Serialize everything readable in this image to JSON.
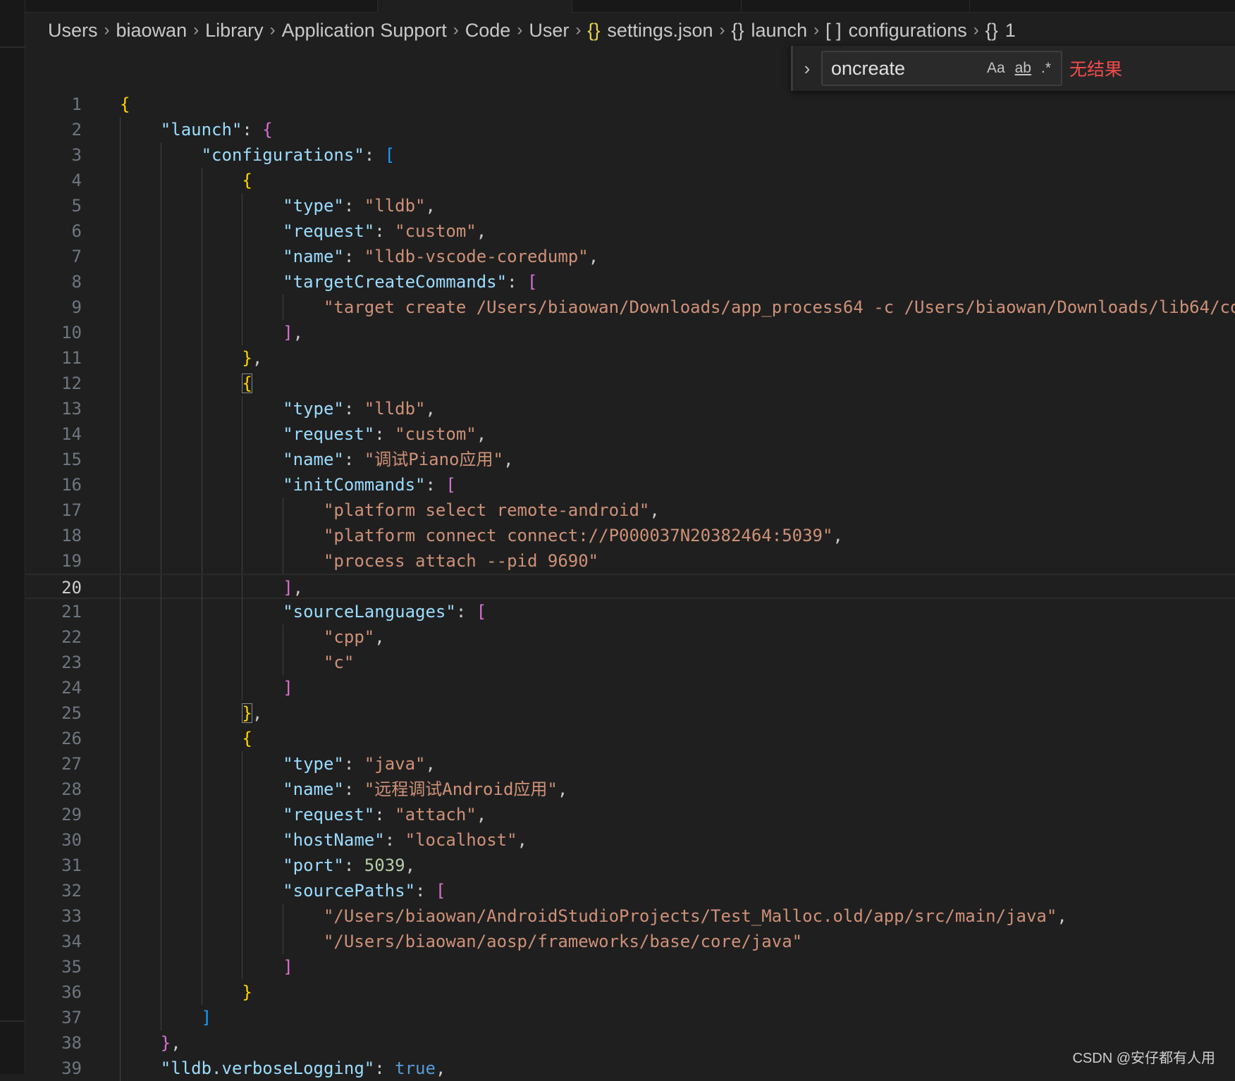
{
  "breadcrumb": [
    {
      "label": "Users"
    },
    {
      "label": "biaowan"
    },
    {
      "label": "Library"
    },
    {
      "label": "Application Support"
    },
    {
      "label": "Code"
    },
    {
      "label": "User"
    },
    {
      "icon": "{}",
      "icon_name": "json-file-icon",
      "label": "settings.json"
    },
    {
      "icon": "{}",
      "icon_name": "object-icon",
      "label": "launch"
    },
    {
      "icon": "[ ]",
      "icon_name": "array-icon",
      "label": "configurations"
    },
    {
      "icon": "{}",
      "icon_name": "object-icon",
      "label": "1"
    }
  ],
  "find": {
    "value": "oncreate",
    "match_case": "Aa",
    "whole_word": "ab",
    "regex": ".*",
    "result": "无结果",
    "toggle": "›"
  },
  "editor": {
    "current_line": 20,
    "matched_brackets": [
      12,
      25
    ],
    "lines": [
      [
        [
          "y",
          "{"
        ]
      ],
      [
        [
          "w",
          "    "
        ],
        [
          "k",
          "\"launch\""
        ],
        [
          "p",
          ": "
        ],
        [
          "m",
          "{"
        ]
      ],
      [
        [
          "w",
          "        "
        ],
        [
          "k",
          "\"configurations\""
        ],
        [
          "p",
          ": "
        ],
        [
          "c",
          "["
        ]
      ],
      [
        [
          "w",
          "            "
        ],
        [
          "y",
          "{"
        ]
      ],
      [
        [
          "w",
          "                "
        ],
        [
          "k",
          "\"type\""
        ],
        [
          "p",
          ": "
        ],
        [
          "s",
          "\"lldb\""
        ],
        [
          "p",
          ","
        ]
      ],
      [
        [
          "w",
          "                "
        ],
        [
          "k",
          "\"request\""
        ],
        [
          "p",
          ": "
        ],
        [
          "s",
          "\"custom\""
        ],
        [
          "p",
          ","
        ]
      ],
      [
        [
          "w",
          "                "
        ],
        [
          "k",
          "\"name\""
        ],
        [
          "p",
          ": "
        ],
        [
          "s",
          "\"lldb-vscode-coredump\""
        ],
        [
          "p",
          ","
        ]
      ],
      [
        [
          "w",
          "                "
        ],
        [
          "k",
          "\"targetCreateCommands\""
        ],
        [
          "p",
          ": "
        ],
        [
          "m",
          "["
        ]
      ],
      [
        [
          "w",
          "                    "
        ],
        [
          "s",
          "\"target create /Users/biaowan/Downloads/app_process64 -c /Users/biaowan/Downloads/lib64/co"
        ]
      ],
      [
        [
          "w",
          "                "
        ],
        [
          "m",
          "]"
        ],
        [
          "p",
          ","
        ]
      ],
      [
        [
          "w",
          "            "
        ],
        [
          "y",
          "}"
        ],
        [
          "p",
          ","
        ]
      ],
      [
        [
          "w",
          "            "
        ],
        [
          "y",
          "{"
        ]
      ],
      [
        [
          "w",
          "                "
        ],
        [
          "k",
          "\"type\""
        ],
        [
          "p",
          ": "
        ],
        [
          "s",
          "\"lldb\""
        ],
        [
          "p",
          ","
        ]
      ],
      [
        [
          "w",
          "                "
        ],
        [
          "k",
          "\"request\""
        ],
        [
          "p",
          ": "
        ],
        [
          "s",
          "\"custom\""
        ],
        [
          "p",
          ","
        ]
      ],
      [
        [
          "w",
          "                "
        ],
        [
          "k",
          "\"name\""
        ],
        [
          "p",
          ": "
        ],
        [
          "s",
          "\"调试Piano应用\""
        ],
        [
          "p",
          ","
        ]
      ],
      [
        [
          "w",
          "                "
        ],
        [
          "k",
          "\"initCommands\""
        ],
        [
          "p",
          ": "
        ],
        [
          "m",
          "["
        ]
      ],
      [
        [
          "w",
          "                    "
        ],
        [
          "s",
          "\"platform select remote-android\""
        ],
        [
          "p",
          ","
        ]
      ],
      [
        [
          "w",
          "                    "
        ],
        [
          "s",
          "\"platform connect connect://P000037N20382464:5039\""
        ],
        [
          "p",
          ","
        ]
      ],
      [
        [
          "w",
          "                    "
        ],
        [
          "s",
          "\"process attach --pid 9690\""
        ]
      ],
      [
        [
          "w",
          "                "
        ],
        [
          "m",
          "]"
        ],
        [
          "p",
          ","
        ]
      ],
      [
        [
          "w",
          "                "
        ],
        [
          "k",
          "\"sourceLanguages\""
        ],
        [
          "p",
          ": "
        ],
        [
          "m",
          "["
        ]
      ],
      [
        [
          "w",
          "                    "
        ],
        [
          "s",
          "\"cpp\""
        ],
        [
          "p",
          ","
        ]
      ],
      [
        [
          "w",
          "                    "
        ],
        [
          "s",
          "\"c\""
        ]
      ],
      [
        [
          "w",
          "                "
        ],
        [
          "m",
          "]"
        ]
      ],
      [
        [
          "w",
          "            "
        ],
        [
          "y",
          "}"
        ],
        [
          "p",
          ","
        ]
      ],
      [
        [
          "w",
          "            "
        ],
        [
          "y",
          "{"
        ]
      ],
      [
        [
          "w",
          "                "
        ],
        [
          "k",
          "\"type\""
        ],
        [
          "p",
          ": "
        ],
        [
          "s",
          "\"java\""
        ],
        [
          "p",
          ","
        ]
      ],
      [
        [
          "w",
          "                "
        ],
        [
          "k",
          "\"name\""
        ],
        [
          "p",
          ": "
        ],
        [
          "s",
          "\"远程调试Android应用\""
        ],
        [
          "p",
          ","
        ]
      ],
      [
        [
          "w",
          "                "
        ],
        [
          "k",
          "\"request\""
        ],
        [
          "p",
          ": "
        ],
        [
          "s",
          "\"attach\""
        ],
        [
          "p",
          ","
        ]
      ],
      [
        [
          "w",
          "                "
        ],
        [
          "k",
          "\"hostName\""
        ],
        [
          "p",
          ": "
        ],
        [
          "s",
          "\"localhost\""
        ],
        [
          "p",
          ","
        ]
      ],
      [
        [
          "w",
          "                "
        ],
        [
          "k",
          "\"port\""
        ],
        [
          "p",
          ": "
        ],
        [
          "n",
          "5039"
        ],
        [
          "p",
          ","
        ]
      ],
      [
        [
          "w",
          "                "
        ],
        [
          "k",
          "\"sourcePaths\""
        ],
        [
          "p",
          ": "
        ],
        [
          "m",
          "["
        ]
      ],
      [
        [
          "w",
          "                    "
        ],
        [
          "s",
          "\"/Users/biaowan/AndroidStudioProjects/Test_Malloc.old/app/src/main/java\""
        ],
        [
          "p",
          ","
        ]
      ],
      [
        [
          "w",
          "                    "
        ],
        [
          "s",
          "\"/Users/biaowan/aosp/frameworks/base/core/java\""
        ]
      ],
      [
        [
          "w",
          "                "
        ],
        [
          "m",
          "]"
        ]
      ],
      [
        [
          "w",
          "            "
        ],
        [
          "y",
          "}"
        ]
      ],
      [
        [
          "w",
          "        "
        ],
        [
          "c",
          "]"
        ]
      ],
      [
        [
          "w",
          "    "
        ],
        [
          "m",
          "}"
        ],
        [
          "p",
          ","
        ]
      ],
      [
        [
          "w",
          "    "
        ],
        [
          "k",
          "\"lldb.verboseLogging\""
        ],
        [
          "p",
          ": "
        ],
        [
          "b",
          "true"
        ],
        [
          "p",
          ","
        ]
      ]
    ]
  },
  "watermark": "CSDN @安仔都有人用"
}
